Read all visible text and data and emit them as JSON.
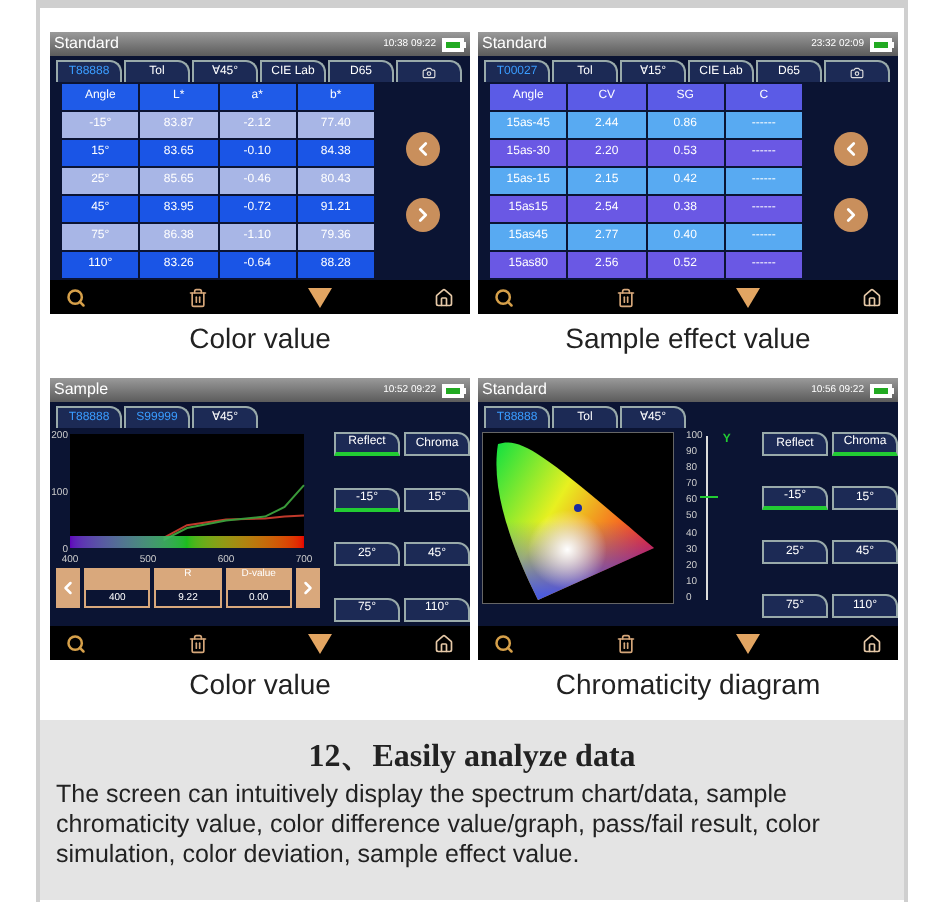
{
  "panels": [
    {
      "kind": "lab_table",
      "caption": "Color value",
      "screen": {
        "title": "Standard",
        "time": "10:38 09:22",
        "tabs": [
          {
            "kind": "record",
            "label": "T88888"
          },
          {
            "kind": "setting",
            "label": "Tol"
          },
          {
            "kind": "setting",
            "label": "∀45°"
          },
          {
            "kind": "setting",
            "label": "CIE Lab"
          },
          {
            "kind": "setting",
            "label": "D65"
          },
          {
            "kind": "camera"
          }
        ],
        "table": {
          "columns": [
            "Angle",
            "L*",
            "a*",
            "b*"
          ],
          "rows": [
            [
              "-15°",
              "83.87",
              "-2.12",
              "77.40"
            ],
            [
              "15°",
              "83.65",
              "-0.10",
              "84.38"
            ],
            [
              "25°",
              "85.65",
              "-0.46",
              "80.43"
            ],
            [
              "45°",
              "83.95",
              "-0.72",
              "91.21"
            ],
            [
              "75°",
              "86.38",
              "-1.10",
              "79.36"
            ],
            [
              "110°",
              "83.26",
              "-0.64",
              "88.28"
            ]
          ]
        }
      }
    },
    {
      "kind": "effect_table",
      "caption": "Sample effect value",
      "screen": {
        "title": "Standard",
        "time": "23:32 02:09",
        "tabs": [
          {
            "kind": "record",
            "label": "T00027"
          },
          {
            "kind": "setting",
            "label": "Tol"
          },
          {
            "kind": "setting",
            "label": "∀15°"
          },
          {
            "kind": "setting",
            "label": "CIE Lab"
          },
          {
            "kind": "setting",
            "label": "D65"
          },
          {
            "kind": "camera"
          }
        ],
        "table": {
          "columns": [
            "Angle",
            "CV",
            "SG",
            "C"
          ],
          "rows": [
            [
              "15as-45",
              "2.44",
              "0.86",
              "------"
            ],
            [
              "15as-30",
              "2.20",
              "0.53",
              "------"
            ],
            [
              "15as-15",
              "2.15",
              "0.42",
              "------"
            ],
            [
              "15as15",
              "2.54",
              "0.38",
              "------"
            ],
            [
              "15as45",
              "2.77",
              "0.40",
              "------"
            ],
            [
              "15as80",
              "2.56",
              "0.52",
              "------"
            ]
          ]
        }
      }
    },
    {
      "kind": "spectrum",
      "caption": "Color value",
      "screen": {
        "title": "Sample",
        "time": "10:52 09:22",
        "tabs": [
          {
            "kind": "record",
            "label": "T88888"
          },
          {
            "kind": "record",
            "label": "S99999"
          },
          {
            "kind": "setting",
            "label": "∀45°"
          }
        ],
        "chart_data": {
          "type": "line",
          "x": [
            520,
            550,
            600,
            650,
            675,
            700
          ],
          "series": [
            {
              "color": "#c0392b",
              "values": [
                18,
                40,
                50,
                52,
                55,
                57
              ]
            },
            {
              "color": "#3a9a3a",
              "values": [
                14,
                35,
                48,
                55,
                72,
                110
              ]
            }
          ],
          "xlim": [
            400,
            700
          ],
          "ylim": [
            0,
            200
          ],
          "xticks": [
            400,
            500,
            600,
            700
          ],
          "yticks": [
            0,
            100,
            200
          ]
        },
        "readouts": [
          {
            "value": "400"
          },
          {
            "label": "R",
            "value": "9.22"
          },
          {
            "label": "D-value",
            "value": "0.00"
          }
        ],
        "modes": [
          {
            "label": "Reflect",
            "selected": true
          },
          {
            "label": "Chroma",
            "selected": false
          }
        ],
        "angles": [
          {
            "label": "-15°",
            "selected": true
          },
          {
            "label": "15°",
            "selected": false
          },
          {
            "label": "25°",
            "selected": false
          },
          {
            "label": "45°",
            "selected": false
          },
          {
            "label": "75°",
            "selected": false
          },
          {
            "label": "110°",
            "selected": false
          }
        ]
      }
    },
    {
      "kind": "chromaticity",
      "caption": "Chromaticity diagram",
      "screen": {
        "title": "Standard",
        "time": "10:56 09:22",
        "tabs": [
          {
            "kind": "record",
            "label": "T88888"
          },
          {
            "kind": "setting",
            "label": "Tol"
          },
          {
            "kind": "setting",
            "label": "∀45°"
          }
        ],
        "y_scale": {
          "label": "Y",
          "ticks": [
            "100",
            "90",
            "80",
            "70",
            "60",
            "50",
            "40",
            "30",
            "20",
            "10",
            "0"
          ],
          "level": 0.62
        },
        "modes": [
          {
            "label": "Reflect",
            "selected": false
          },
          {
            "label": "Chroma",
            "selected": true
          }
        ],
        "angles": [
          {
            "label": "-15°",
            "selected": true
          },
          {
            "label": "15°",
            "selected": false
          },
          {
            "label": "25°",
            "selected": false
          },
          {
            "label": "45°",
            "selected": false
          },
          {
            "label": "75°",
            "selected": false
          },
          {
            "label": "110°",
            "selected": false
          }
        ]
      }
    }
  ],
  "section": {
    "title": "12、Easily analyze data",
    "body": "The screen can intuitively display the spectrum chart/data, sample chromaticity value, color difference value/graph, pass/fail result, color simulation, color deviation, sample effect value."
  }
}
